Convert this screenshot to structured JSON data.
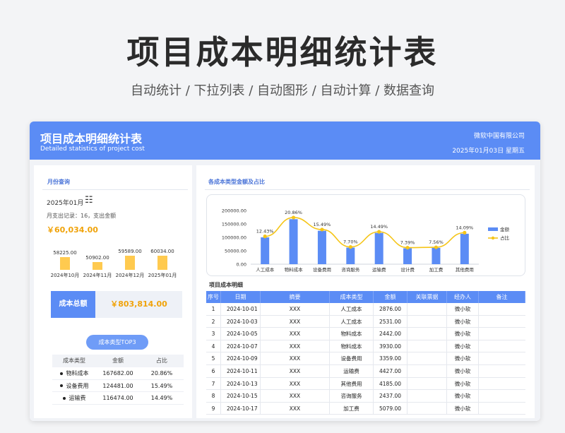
{
  "page": {
    "title": "项目成本明细统计表",
    "subtitle": "自动统计  /  下拉列表  /  自动图形  /  自动计算  /  数据查询"
  },
  "header": {
    "title": "项目成本明细统计表",
    "subtitle": "Detailed statistics of project cost",
    "company": "微软中国有限公司",
    "date": "2025年01月03日    星期五"
  },
  "left": {
    "section_title": "月份查询",
    "month": "2025年01月",
    "month_icon": "dropdown-calendar-icon",
    "record_text": "月支出记录：16，支出金额",
    "amount": "￥60,034.00",
    "monthly": [
      {
        "label": "2024年10月",
        "value_text": "58225.00",
        "value": 58225
      },
      {
        "label": "2024年11月",
        "value_text": "50902.00",
        "value": 50902
      },
      {
        "label": "2024年12月",
        "value_text": "59589.00",
        "value": 59589
      },
      {
        "label": "2025年01月",
        "value_text": "60034.00",
        "value": 60034
      }
    ],
    "total_label": "成本总额",
    "total_value": "￥803,814.00",
    "top3_title": "成本类型TOP3",
    "top3_headers": [
      "成本类型",
      "金额",
      "占比"
    ],
    "top3_rows": [
      [
        "物料成本",
        "167682.00",
        "20.86%"
      ],
      [
        "设备费用",
        "124481.00",
        "15.49%"
      ],
      [
        "运输费",
        "116474.00",
        "14.49%"
      ]
    ]
  },
  "right": {
    "chart_title": "各成本类型金额及占比",
    "table_title": "项目成本明细",
    "table_headers": [
      "序号",
      "日期",
      "摘要",
      "成本类型",
      "金额",
      "关联票据",
      "经办人",
      "备注"
    ],
    "table_rows": [
      [
        "1",
        "2024-10-01",
        "XXX",
        "人工成本",
        "2876.00",
        "",
        "微小软",
        ""
      ],
      [
        "2",
        "2024-10-03",
        "XXX",
        "人工成本",
        "2531.00",
        "",
        "微小软",
        ""
      ],
      [
        "3",
        "2024-10-05",
        "XXX",
        "物料成本",
        "2442.00",
        "",
        "微小软",
        ""
      ],
      [
        "4",
        "2024-10-07",
        "XXX",
        "物料成本",
        "3930.00",
        "",
        "微小软",
        ""
      ],
      [
        "5",
        "2024-10-09",
        "XXX",
        "设备费用",
        "3359.00",
        "",
        "微小软",
        ""
      ],
      [
        "6",
        "2024-10-11",
        "XXX",
        "运输费",
        "4427.00",
        "",
        "微小软",
        ""
      ],
      [
        "7",
        "2024-10-13",
        "XXX",
        "其他费用",
        "4185.00",
        "",
        "微小软",
        ""
      ],
      [
        "8",
        "2024-10-15",
        "XXX",
        "咨询服务",
        "2437.00",
        "",
        "微小软",
        ""
      ],
      [
        "9",
        "2024-10-17",
        "XXX",
        "加工费",
        "5079.00",
        "",
        "微小软",
        ""
      ]
    ]
  },
  "colors": {
    "accent": "#5b8cf5",
    "bar": "#5b8cf5",
    "line": "#f5c518",
    "mini_bar": "#ffca4f",
    "amount": "#f0a30a"
  },
  "chart_data": {
    "type": "bar",
    "categories": [
      "人工成本",
      "物料成本",
      "设备费用",
      "咨询服务",
      "运输费",
      "设计费",
      "加工费",
      "其他费用"
    ],
    "series": [
      {
        "name": "金额",
        "type": "bar",
        "values": [
          99900,
          167682,
          124481,
          61900,
          116474,
          59400,
          60800,
          113300
        ]
      },
      {
        "name": "占比",
        "type": "line",
        "values": [
          12.43,
          20.86,
          15.49,
          7.7,
          14.49,
          7.39,
          7.56,
          14.09
        ],
        "labels": [
          "12.43%",
          "20.86%",
          "15.49%",
          "7.70%",
          "14.49%",
          "7.39%",
          "7.56%",
          "14.09%"
        ]
      }
    ],
    "ylim": [
      0,
      200000
    ],
    "yticks": [
      "0.00",
      "50000.00",
      "100000.00",
      "150000.00",
      "200000.00"
    ],
    "legend": "right",
    "grid": false
  }
}
